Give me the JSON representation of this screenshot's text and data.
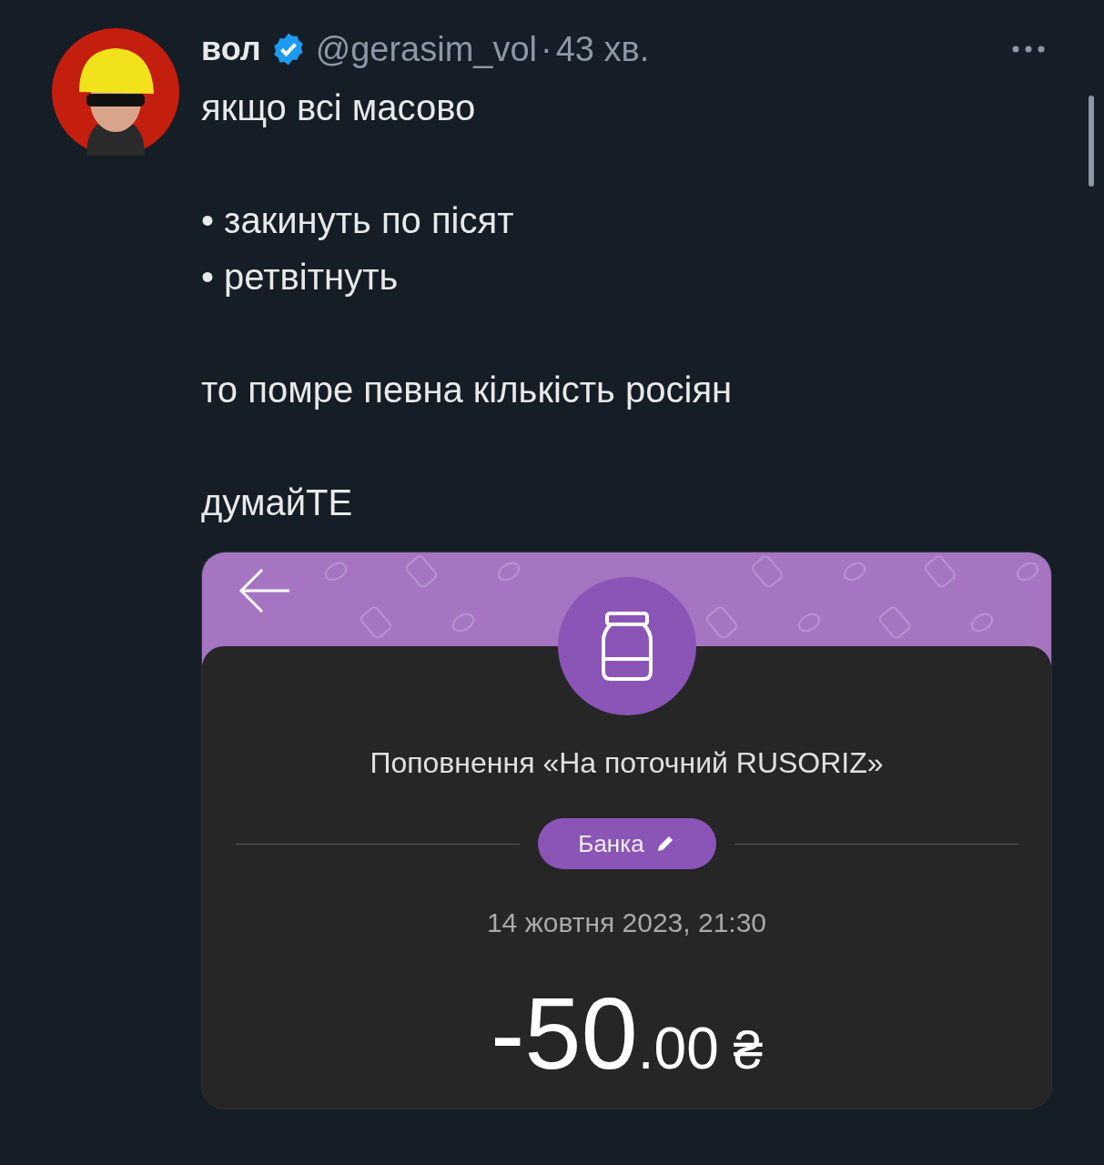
{
  "tweet": {
    "author_name": "вол",
    "verified": true,
    "handle": "@gerasim_vol",
    "separator": "·",
    "time": "43 хв.",
    "paragraphs": [
      [
        "якщо всі масово"
      ],
      [
        "• закинуть по пісят",
        "• ретвітнуть"
      ],
      [
        "то помре певна кількість росіян"
      ],
      [
        "думайТЕ"
      ]
    ],
    "attachment": {
      "title": "Поповнення «На поточний RUSORIZ»",
      "tag": {
        "label": "Банка"
      },
      "date": "14 жовтня 2023, 21:30",
      "amount": {
        "whole": "-50",
        "fraction": ".00",
        "currency": "₴"
      }
    }
  }
}
